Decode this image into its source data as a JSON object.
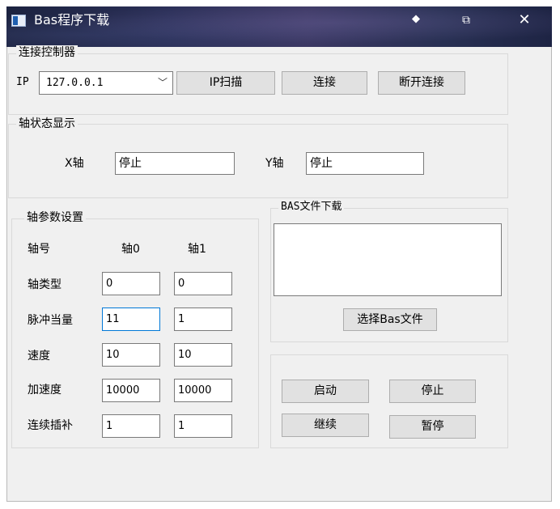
{
  "window": {
    "title": "Bas程序下载",
    "min_symbol": "⯁",
    "max_symbol": "⧉",
    "close_symbol": "✕"
  },
  "connect": {
    "group_label": "连接控制器",
    "ip_label": "IP",
    "ip_value": "127.0.0.1",
    "scan_button": "IP扫描",
    "connect_button": "连接",
    "disconnect_button": "断开连接"
  },
  "axis_status": {
    "group_label": "轴状态显示",
    "x_label": "X轴",
    "x_value": "停止",
    "y_label": "Y轴",
    "y_value": "停止"
  },
  "axis_params": {
    "group_label": "轴参数设置",
    "header_label": "轴号",
    "header_axis0": "轴0",
    "header_axis1": "轴1",
    "rows": [
      {
        "label": "轴类型",
        "axis0": "0",
        "axis1": "0"
      },
      {
        "label": "脉冲当量",
        "axis0": "11",
        "axis1": "1"
      },
      {
        "label": "速度",
        "axis0": "10",
        "axis1": "10"
      },
      {
        "label": "加速度",
        "axis0": "10000",
        "axis1": "10000"
      },
      {
        "label": "连续插补",
        "axis0": "1",
        "axis1": "1"
      }
    ]
  },
  "bas_download": {
    "group_label": "BAS文件下载",
    "file_list": "",
    "select_button": "选择Bas文件"
  },
  "controls": {
    "start_button": "启动",
    "stop_button": "停止",
    "continue_button": "继续",
    "pause_button": "暂停"
  }
}
